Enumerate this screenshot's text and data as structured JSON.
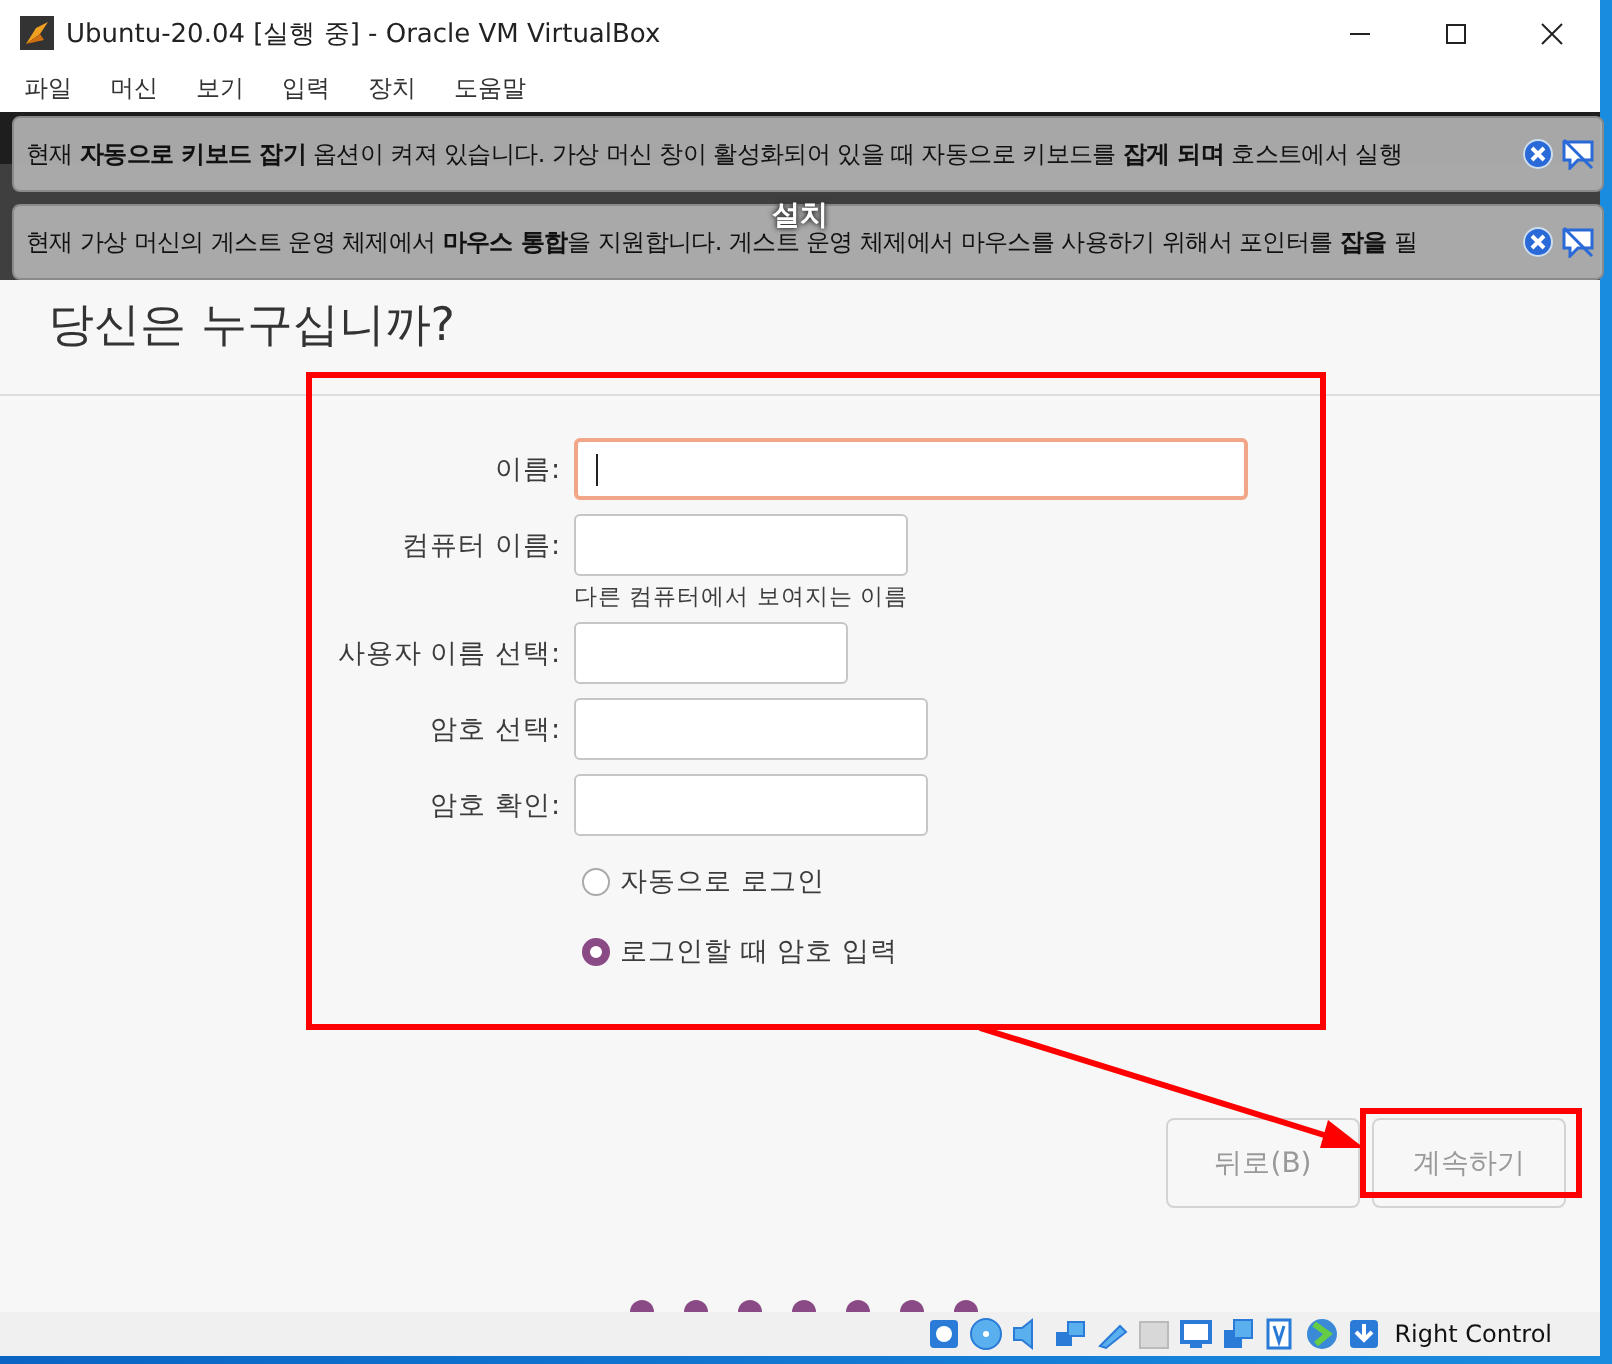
{
  "window": {
    "title": "Ubuntu-20.04 [실행 중] - Oracle VM VirtualBox"
  },
  "menu": [
    "파일",
    "머신",
    "보기",
    "입력",
    "장치",
    "도움말"
  ],
  "notices": [
    {
      "text": "현재 **자동으로 키보드 잡기** 옵션이 켜져 있습니다. 가상 머신 창이 활성화되어 있을 때 자동으로 키보드를 **잡게 되며** 호스트에서 실행"
    },
    {
      "text": "현재 가상 머신의 게스트 운영 체제에서 **마우스 통합**을 지원합니다. 게스트 운영 체제에서 마우스를 사용하기 위해서 포인터를 **잡을** 필"
    }
  ],
  "installer": {
    "title": "설치",
    "heading": "당신은 누구십니까?",
    "fields": [
      {
        "label": "이름:",
        "focused": true
      },
      {
        "label": "컴퓨터 이름:",
        "focused": false,
        "hint": "다른 컴퓨터에서 보여지는 이름"
      },
      {
        "label": "사용자 이름 선택:",
        "focused": false
      },
      {
        "label": "암호 선택:",
        "focused": false
      },
      {
        "label": "암호 확인:",
        "focused": false
      }
    ],
    "login_options": [
      {
        "label": "자동으로 로그인",
        "selected": false
      },
      {
        "label": "로그인할 때 암호 입력",
        "selected": true
      }
    ],
    "buttons": [
      {
        "label": "뒤로(B)",
        "disabled": true
      },
      {
        "label": "계속하기",
        "disabled": true
      }
    ]
  },
  "status_bar": {
    "host_key": "Right Control"
  }
}
